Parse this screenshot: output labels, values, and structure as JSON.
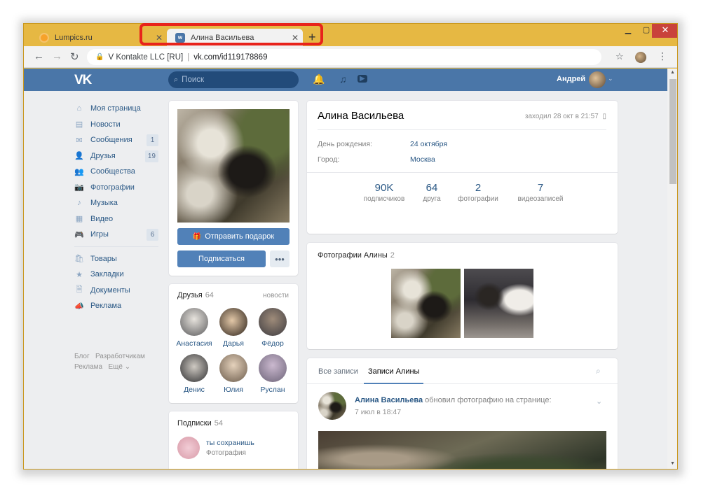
{
  "browser": {
    "tabs": [
      {
        "title": "Lumpics.ru",
        "close": "✕"
      },
      {
        "title": "Алина Васильева",
        "close": "✕"
      }
    ],
    "new_tab": "+",
    "window_controls": {
      "min": "▁",
      "max": "▢",
      "close": "✕"
    },
    "nav": {
      "back": "←",
      "forward": "→",
      "reload": "↻"
    },
    "address": {
      "org": "V Kontakte LLC [RU]",
      "separator": "|",
      "url": "vk.com/id119178869",
      "lock": "🔒"
    },
    "star": "☆",
    "menu": "⋮",
    "highlight_color": "#e8231b"
  },
  "vk_header": {
    "logo": "VK",
    "search_placeholder": "Поиск",
    "search_icon": "⌕",
    "bell_icon": "🔔",
    "music_icon": "♫",
    "video_icon": "▶",
    "user_name": "Андрей",
    "chevron": "⌄",
    "brand_color": "#4a76a8"
  },
  "left_menu": {
    "items": [
      {
        "label": "Моя страница",
        "icon": "⌂",
        "count": ""
      },
      {
        "label": "Новости",
        "icon": "▤",
        "count": ""
      },
      {
        "label": "Сообщения",
        "icon": "✉",
        "count": "1"
      },
      {
        "label": "Друзья",
        "icon": "👤",
        "count": "19"
      },
      {
        "label": "Сообщества",
        "icon": "👥",
        "count": ""
      },
      {
        "label": "Фотографии",
        "icon": "📷",
        "count": ""
      },
      {
        "label": "Музыка",
        "icon": "♪",
        "count": ""
      },
      {
        "label": "Видео",
        "icon": "▦",
        "count": ""
      },
      {
        "label": "Игры",
        "icon": "🎮",
        "count": "6"
      }
    ],
    "items2": [
      {
        "label": "Товары",
        "icon": "🛍"
      },
      {
        "label": "Закладки",
        "icon": "★"
      },
      {
        "label": "Документы",
        "icon": "🗎"
      },
      {
        "label": "Реклама",
        "icon": "📣"
      }
    ],
    "footer": {
      "blog": "Блог",
      "dev": "Разработчикам",
      "ads": "Реклама",
      "more": "Ещё ⌄"
    }
  },
  "profile_card": {
    "gift_button": "Отправить подарок",
    "gift_icon": "🎁",
    "subscribe_button": "Подписаться",
    "more_button": "•••"
  },
  "friends": {
    "title": "Друзья",
    "count": "64",
    "news_link": "новости",
    "list": [
      "Анастасия",
      "Дарья",
      "Фёдор",
      "Денис",
      "Юлия",
      "Руслан"
    ]
  },
  "subscriptions": {
    "title": "Подписки",
    "count": "54",
    "item_name": "ты сохранишь",
    "item_sub": "Фотография"
  },
  "profile": {
    "name": "Алина Васильева",
    "online": "заходил 28 окт в 21:57",
    "online_icon": "▯",
    "birthday_label": "День рождения:",
    "birthday_value": "24 октября",
    "city_label": "Город:",
    "city_value": "Москва",
    "stats": [
      {
        "value": "90K",
        "label": "подписчиков"
      },
      {
        "value": "64",
        "label": "друга"
      },
      {
        "value": "2",
        "label": "фотографии"
      },
      {
        "value": "7",
        "label": "видеозаписей"
      }
    ]
  },
  "photos": {
    "title": "Фотографии Алины",
    "count": "2"
  },
  "wall": {
    "tab_all": "Все записи",
    "tab_own": "Записи Алины",
    "search_icon": "⌕",
    "post_author": "Алина Васильева",
    "post_action": "обновил фотографию на странице:",
    "post_date": "7 июл в 18:47",
    "post_chevron": "⌄"
  },
  "scrollbar": {
    "up": "▲",
    "down": "▼"
  }
}
